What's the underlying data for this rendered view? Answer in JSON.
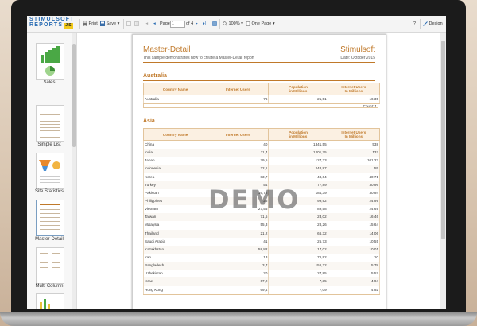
{
  "toolbar": {
    "brand_line1": "STIMULSOFT",
    "brand_line2": "REPORTS",
    "brand_badge": "JS",
    "print_label": "Print",
    "save_label": "Save",
    "page_label": "Page",
    "page_value": "1",
    "page_of": "of 4",
    "zoom_label": "100%",
    "view_mode_label": "One Page",
    "help_label": "?",
    "design_label": "Design"
  },
  "thumbnails": [
    {
      "label": "Sales"
    },
    {
      "label": "Simple List"
    },
    {
      "label": "Site Statistics"
    },
    {
      "label": "Master-Detail"
    },
    {
      "label": "Multi Column"
    }
  ],
  "report": {
    "title": "Master-Detail",
    "company": "Stimulsoft",
    "subtitle": "This sample demonstrates how to create a Master-Detail report",
    "date": "Date: October 2015",
    "watermark": "DEMO",
    "columns": [
      "Country Name",
      "Internet Users",
      "Population\nin Millions",
      "Internet Users\nIn Millions"
    ],
    "groups": [
      {
        "name": "Australia",
        "rows": [
          [
            "Australia",
            "76",
            "21,51",
            "16,35"
          ]
        ],
        "count": "Count: 1"
      },
      {
        "name": "Asia",
        "rows": [
          [
            "China",
            "40",
            "1341,55",
            "538"
          ],
          [
            "India",
            "11,4",
            "1201,75",
            "137"
          ],
          [
            "Japan",
            "79,5",
            "127,33",
            "101,23"
          ],
          [
            "Indonesia",
            "22,1",
            "248,87",
            "55"
          ],
          [
            "Korea",
            "83,7",
            "48,64",
            "40,71"
          ],
          [
            "Turkey",
            "54",
            "77,89",
            "30,96"
          ],
          [
            "Pakistan",
            "16,78",
            "184,39",
            "30,94"
          ],
          [
            "Philippines",
            "25",
            "99,92",
            "24,99"
          ],
          [
            "Vietnam",
            "27,56",
            "89,58",
            "24,69"
          ],
          [
            "Taiwan",
            "71,5",
            "23,02",
            "16,46"
          ],
          [
            "Malaysia",
            "55,3",
            "28,26",
            "15,64"
          ],
          [
            "Thailand",
            "21,2",
            "66,32",
            "14,06"
          ],
          [
            "Saudi Arabia",
            "41",
            "25,73",
            "10,55"
          ],
          [
            "Kazakhstan",
            "58,82",
            "17,02",
            "10,01"
          ],
          [
            "Iran",
            "13",
            "76,92",
            "10"
          ],
          [
            "Bangladesh",
            "3,7",
            "156,22",
            "5,78"
          ],
          [
            "Uzbekistan",
            "20",
            "27,85",
            "5,57"
          ],
          [
            "Israel",
            "67,2",
            "7,35",
            "4,94"
          ],
          [
            "Hong Kong",
            "69,4",
            "7,09",
            "4,92"
          ]
        ]
      }
    ]
  },
  "colors": {
    "accent": "#c0792a",
    "brand_blue": "#2a6cb3",
    "header_fill": "#fbf0e2"
  }
}
